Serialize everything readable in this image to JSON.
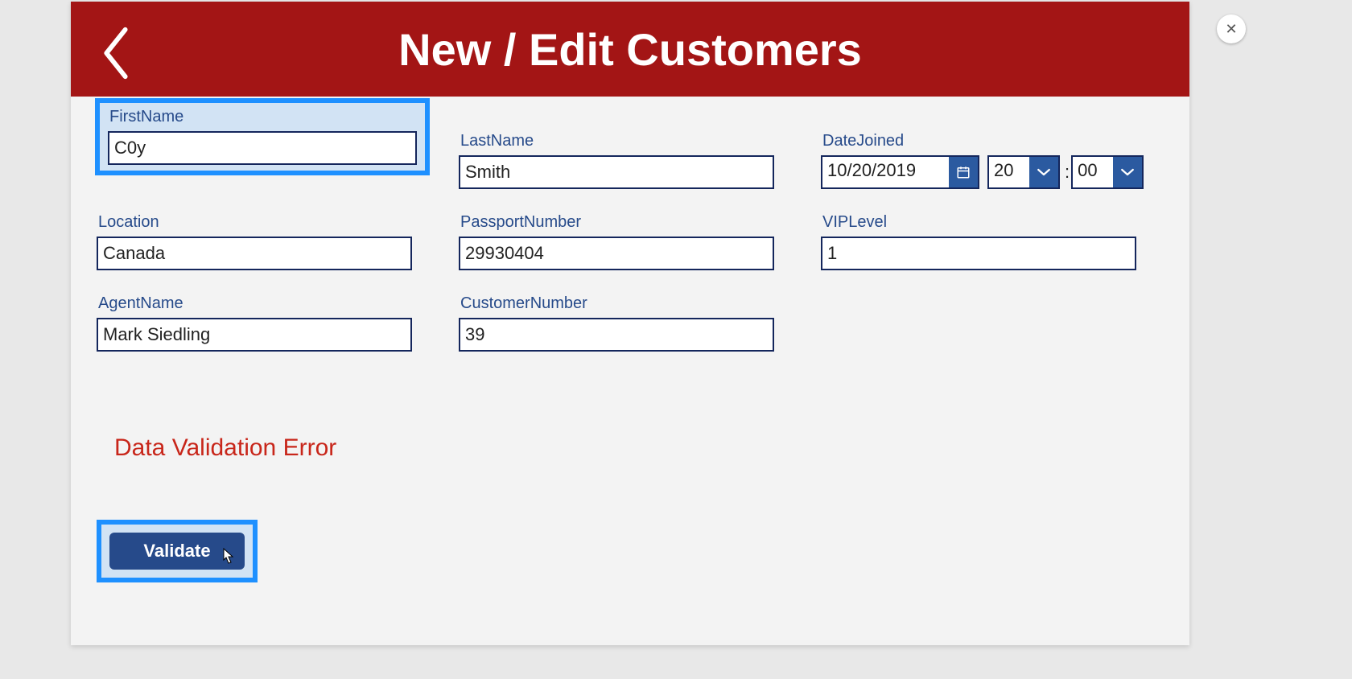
{
  "header": {
    "title": "New / Edit Customers"
  },
  "fields": {
    "firstName": {
      "label": "FirstName",
      "value": "C0y"
    },
    "lastName": {
      "label": "LastName",
      "value": "Smith"
    },
    "dateJoined": {
      "label": "DateJoined",
      "date": "10/20/2019",
      "hour": "20",
      "minute": "00",
      "sep": ":"
    },
    "location": {
      "label": "Location",
      "value": "Canada"
    },
    "passportNumber": {
      "label": "PassportNumber",
      "value": "29930404"
    },
    "vipLevel": {
      "label": "VIPLevel",
      "value": "1"
    },
    "agentName": {
      "label": "AgentName",
      "value": "Mark Siedling"
    },
    "customerNumber": {
      "label": "CustomerNumber",
      "value": "39"
    }
  },
  "status": {
    "error": "Data Validation Error"
  },
  "buttons": {
    "validate": "Validate"
  }
}
